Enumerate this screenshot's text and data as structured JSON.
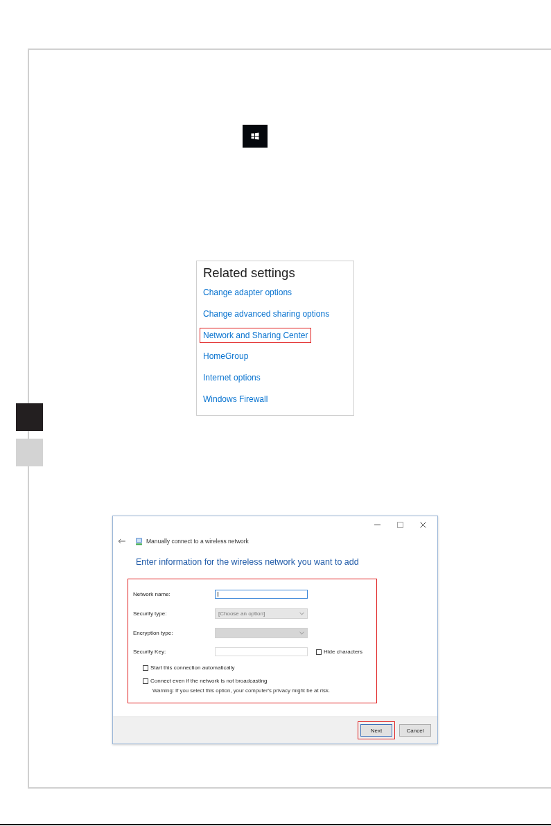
{
  "related_settings": {
    "title": "Related settings",
    "links": [
      {
        "label": "Change adapter options",
        "highlighted": false
      },
      {
        "label": "Change advanced sharing options",
        "highlighted": false
      },
      {
        "label": "Network and Sharing Center",
        "highlighted": true
      },
      {
        "label": "HomeGroup",
        "highlighted": false
      },
      {
        "label": "Internet options",
        "highlighted": false
      },
      {
        "label": "Windows Firewall",
        "highlighted": false
      }
    ]
  },
  "side_tabs": [
    {
      "selected": true
    },
    {
      "selected": false
    }
  ],
  "dialog": {
    "title": "Manually connect to a wireless network",
    "heading": "Enter information for the wireless network you want to add",
    "fields": [
      {
        "label": "Network name:",
        "kind": "text",
        "focused": true,
        "disabled": false
      },
      {
        "label": "Security type:",
        "kind": "select",
        "value": "[Choose an option]",
        "disabled": false
      },
      {
        "label": "Encryption type:",
        "kind": "select",
        "disabled": true
      },
      {
        "label": "Security Key:",
        "kind": "text",
        "focused": false,
        "disabled": true,
        "checkbox": {
          "label": "Hide characters",
          "checked": false
        }
      }
    ],
    "options": [
      {
        "label": "Start this connection automatically",
        "checked": false
      },
      {
        "label": "Connect even if the network is not broadcasting",
        "checked": false
      }
    ],
    "warning": "Warning: If you select this option, your computer's privacy might be at risk.",
    "buttons": [
      {
        "label": "Next",
        "highlighted": true
      },
      {
        "label": "Cancel",
        "highlighted": false
      }
    ]
  }
}
